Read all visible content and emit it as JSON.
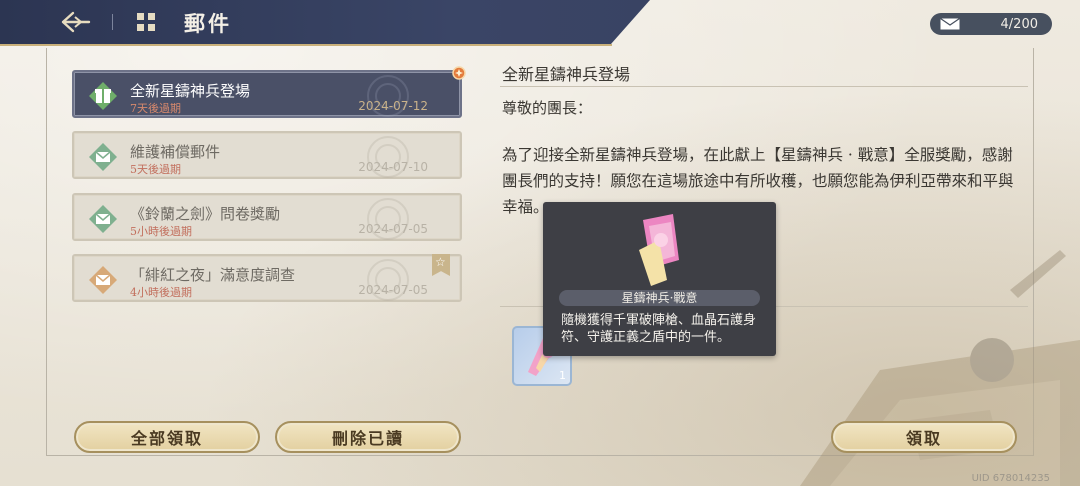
{
  "header": {
    "title": "郵件",
    "mail_count": "4/200"
  },
  "mail_list": [
    {
      "subject": "全新星鑄神兵登場",
      "expiry": "7天後過期",
      "date": "2024-07-12",
      "icon": "gift-icon",
      "state": "active"
    },
    {
      "subject": "維護補償郵件",
      "expiry": "5天後過期",
      "date": "2024-07-10",
      "icon": "letter-icon-green",
      "state": "read"
    },
    {
      "subject": "《鈴蘭之劍》問卷獎勵",
      "expiry": "5小時後過期",
      "date": "2024-07-05",
      "icon": "letter-icon-green",
      "state": "read"
    },
    {
      "subject": "「緋紅之夜」滿意度調查",
      "expiry": "4小時後過期",
      "date": "2024-07-05",
      "icon": "letter-icon-orange",
      "state": "read"
    }
  ],
  "detail": {
    "title": "全新星鑄神兵登場",
    "greeting": "尊敬的團長：",
    "body": "為了迎接全新星鑄神兵登場，在此獻上【星鑄神兵 · 戰意】全服獎勵，感謝團長們的支持！願您在這場旅途中有所收穫，也願您能為伊利亞帶來和平與幸福。",
    "attachment": {
      "quantity": "1",
      "icon": "star-weapon-item-icon"
    }
  },
  "tooltip": {
    "name": "星鑄神兵·戰意",
    "description": "隨機獲得千軍破陣槍、血晶石護身符、守護正義之盾中的一件。"
  },
  "buttons": {
    "claim_all": "全部領取",
    "delete_read": "刪除已讀",
    "claim": "領取"
  },
  "footer": {
    "uid": "UID 678014235"
  },
  "colors": {
    "topbar": "#2c3552",
    "active_item": "#4a5067",
    "expiry": "#c26f5d",
    "button_fill": "#e9d9ae"
  }
}
